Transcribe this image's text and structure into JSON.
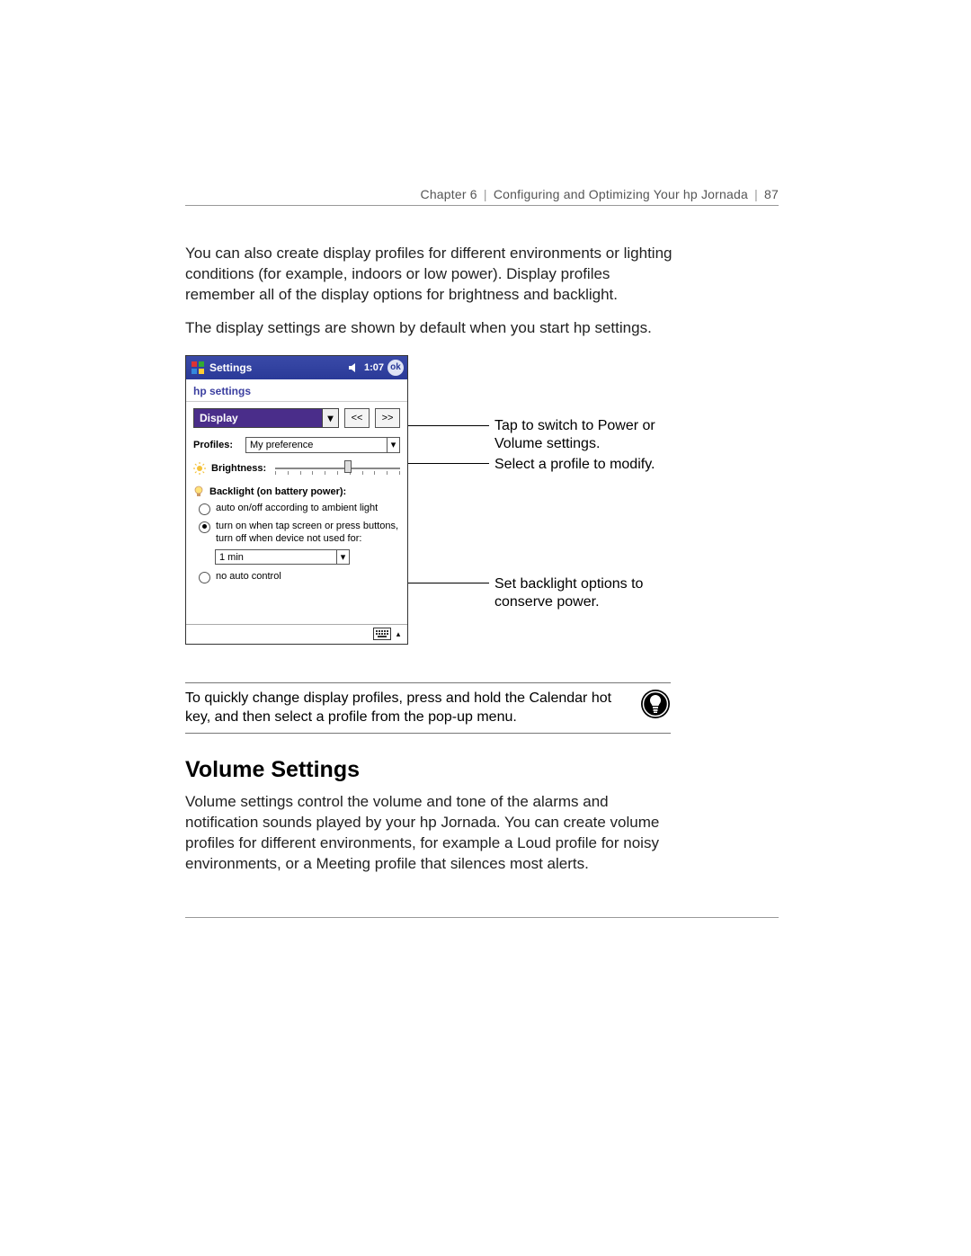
{
  "header": {
    "chapter": "Chapter 6",
    "title": "Configuring and Optimizing Your hp Jornada",
    "page": "87"
  },
  "paragraphs": {
    "p1": "You can also create display profiles for different environments or lighting conditions (for example, indoors or low power). Display profiles remember all of the display options for brightness and backlight.",
    "p2": "The display settings are shown by default when you start hp settings."
  },
  "device": {
    "titlebar": {
      "title": "Settings",
      "time": "1:07",
      "ok": "ok"
    },
    "subhead": "hp settings",
    "mode_select": "Display",
    "nav_prev": "<<",
    "nav_next": ">>",
    "profiles_label": "Profiles:",
    "profile_value": "My preference",
    "brightness_label": "Brightness:",
    "backlight_heading": "Backlight (on battery power):",
    "radio1": "auto on/off according to ambient light",
    "radio2": "turn on when tap screen or press buttons, turn off when device not used for:",
    "time_value": "1 min",
    "radio3": "no auto control"
  },
  "callouts": {
    "c1": "Tap to switch to Power or Volume settings.",
    "c2": "Select a profile to modify.",
    "c3": "Set backlight options to conserve power."
  },
  "tip": "To quickly change display profiles, press and hold the Calendar hot key, and then select a profile from the pop-up menu.",
  "section_heading": "Volume Settings",
  "volume_para": "Volume settings control the volume and tone of the alarms and notification sounds played by your hp Jornada. You can create volume profiles for different environments, for example a Loud profile for noisy environments, or a Meeting profile that silences most alerts."
}
